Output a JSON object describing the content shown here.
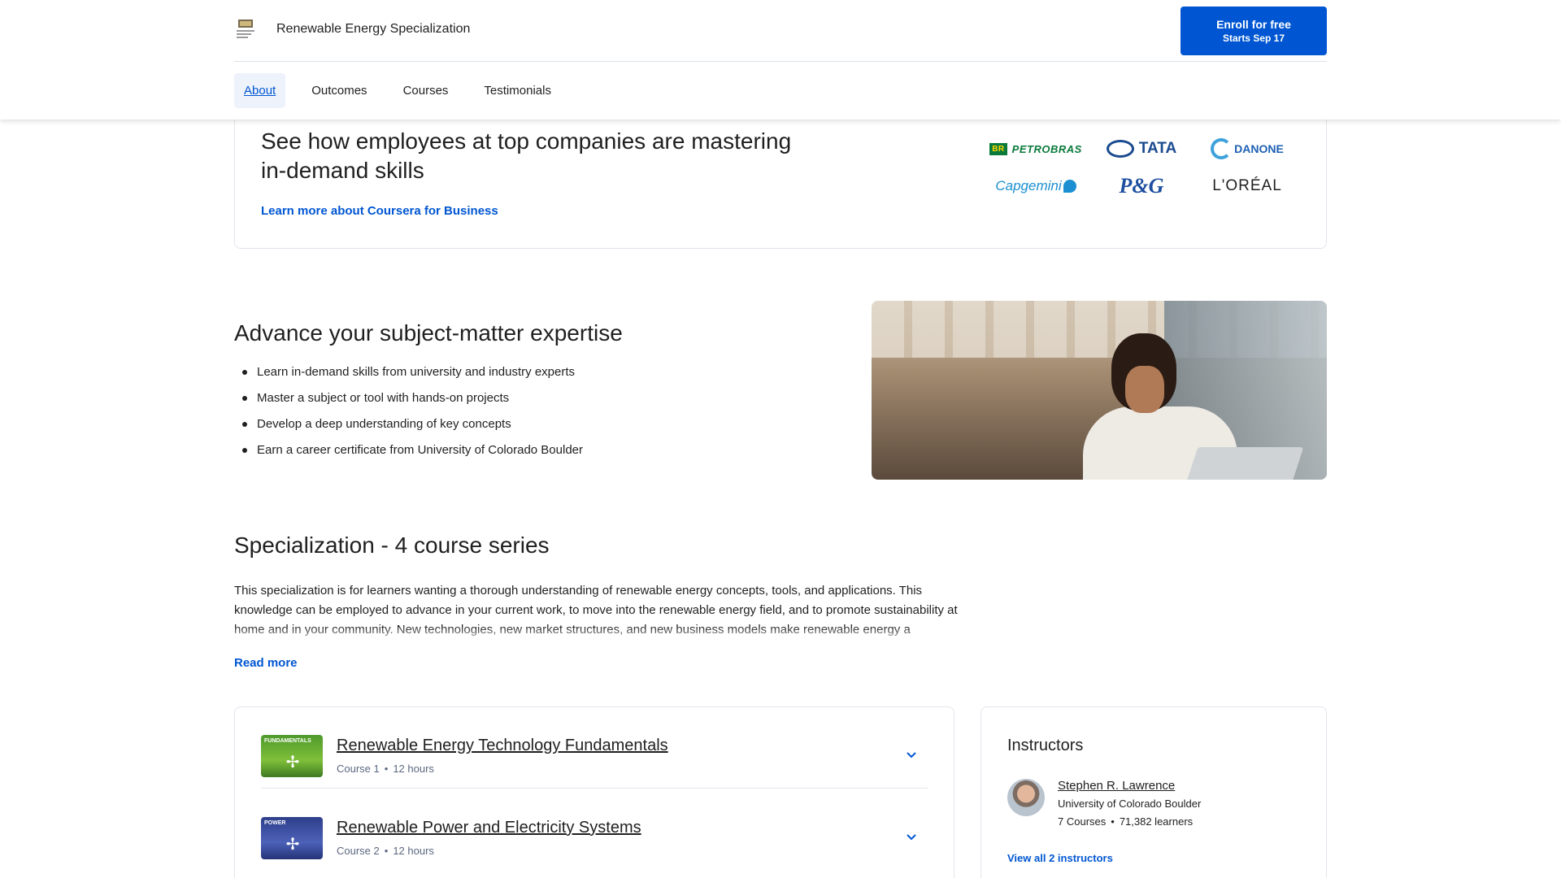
{
  "header": {
    "title": "Renewable Energy Specialization",
    "enroll_label": "Enroll for free",
    "enroll_sub": "Starts Sep 17",
    "brand_color": "#0056d2"
  },
  "nav": {
    "items": [
      {
        "label": "About",
        "active": true
      },
      {
        "label": "Outcomes",
        "active": false
      },
      {
        "label": "Courses",
        "active": false
      },
      {
        "label": "Testimonials",
        "active": false
      }
    ]
  },
  "business": {
    "heading": "See how employees at top companies are mastering in-demand skills",
    "link": "Learn more about Coursera for Business",
    "logos": {
      "petrobras": "PETROBRAS",
      "petrobras_mark": "BR",
      "tata": "TATA",
      "danone": "DANONE",
      "capgemini": "Capgemini",
      "pg": "P&G",
      "loreal": "L'ORÉAL"
    }
  },
  "advance": {
    "title": "Advance your subject-matter expertise",
    "bullets": [
      "Learn in-demand skills from university and industry experts",
      "Master a subject or tool with hands-on projects",
      "Develop a deep understanding of key concepts",
      "Earn a career certificate from University of Colorado Boulder"
    ]
  },
  "specialization": {
    "title": "Specialization - 4 course series",
    "description": "This specialization is for learners wanting a thorough understanding of renewable energy concepts, tools, and applications. This knowledge can be employed to advance in your current work, to move into the renewable energy field, and to promote sustainability at home and in your community. New technologies, new market structures, and new business models make renewable energy a",
    "read_more": "Read more"
  },
  "courses": [
    {
      "title": "Renewable Energy Technology Fundamentals",
      "number": "Course 1",
      "hours": "12 hours",
      "thumb_label": "FUNDAMENTALS"
    },
    {
      "title": "Renewable Power and Electricity Systems",
      "number": "Course 2",
      "hours": "12 hours",
      "thumb_label": "POWER"
    }
  ],
  "instructors": {
    "title": "Instructors",
    "name": "Stephen R. Lawrence",
    "university": "University of Colorado Boulder",
    "courses": "7 Courses",
    "learners": "71,382 learners",
    "view_all": "View all 2 instructors"
  }
}
